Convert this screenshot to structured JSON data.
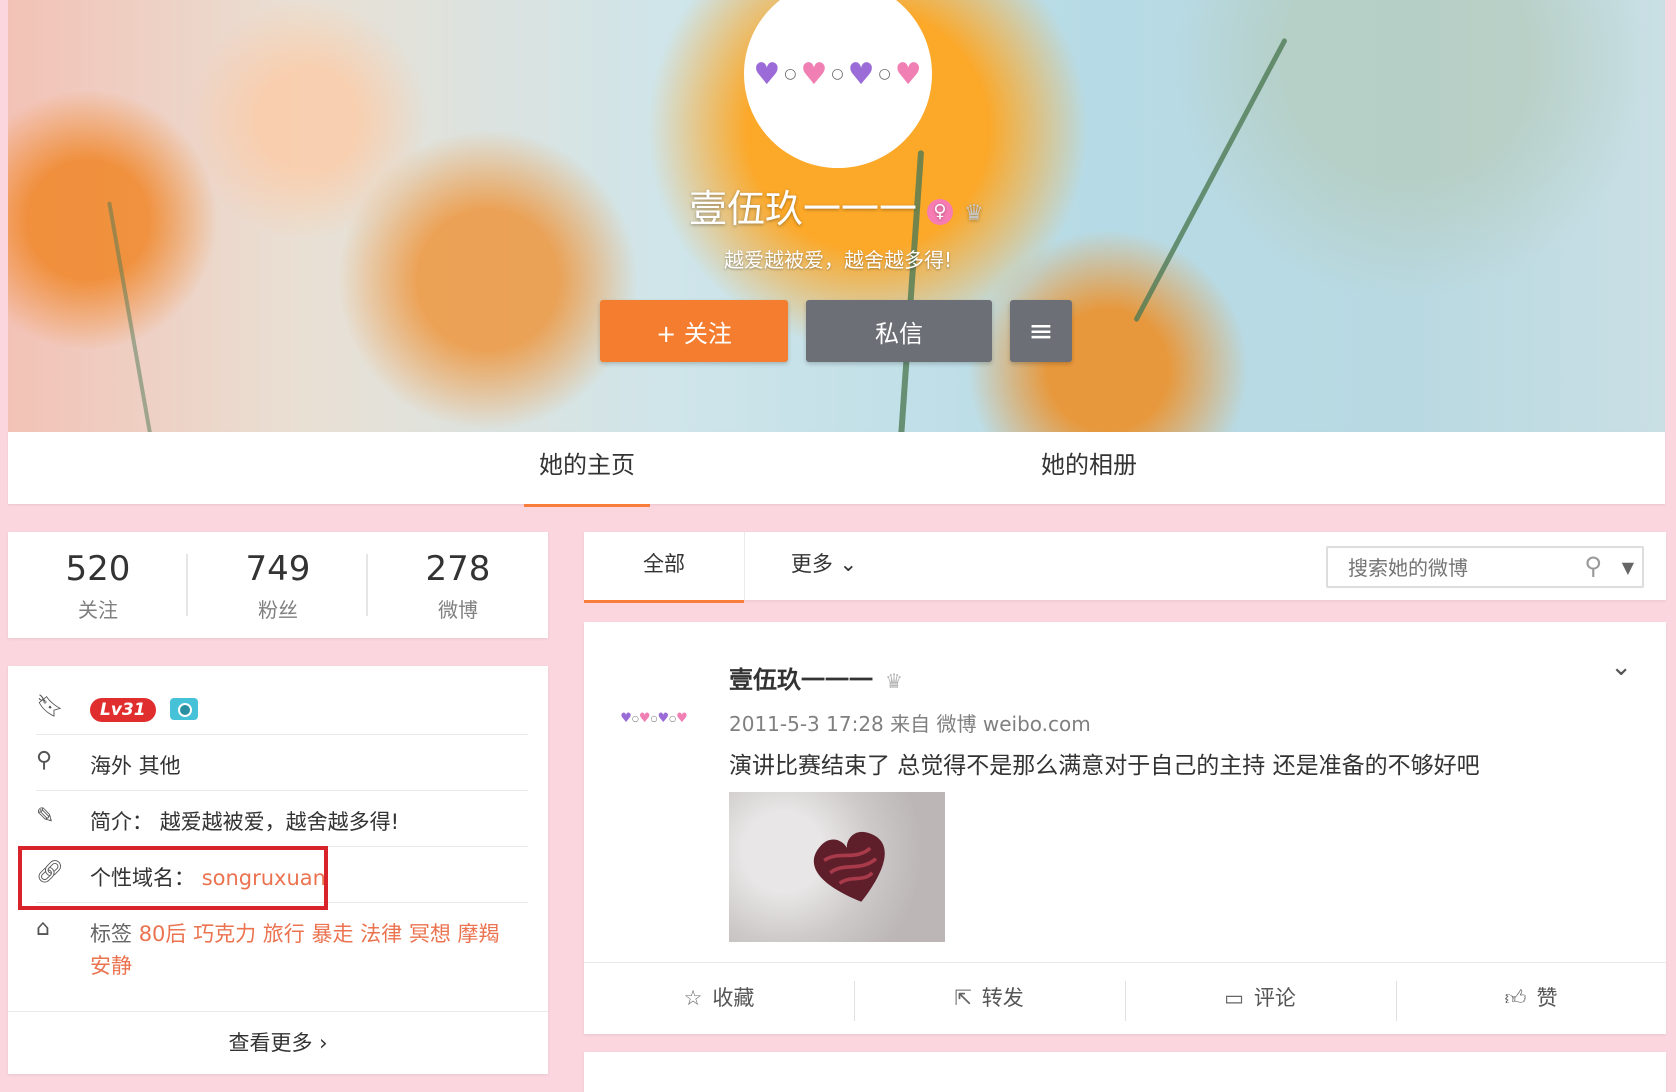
{
  "profile": {
    "name": "壹伍玖一一一",
    "bio": "越爱越被爱，越舍越多得!",
    "follow_button": "+ 关注",
    "message_button": "私信",
    "menu_button": "≡"
  },
  "nav_tabs": [
    {
      "label": "她的主页",
      "active": true
    },
    {
      "label": "她的相册",
      "active": false
    }
  ],
  "stats": [
    {
      "value": "520",
      "label": "关注"
    },
    {
      "value": "749",
      "label": "粉丝"
    },
    {
      "value": "278",
      "label": "微博"
    }
  ],
  "info": {
    "level_badge": "Lv31",
    "location": "海外 其他",
    "intro_label": "简介：",
    "intro_value": "越爱越被爱，越舍越多得!",
    "domain_label": "个性域名：",
    "domain_value": "songruxuan",
    "tags_label": "标签",
    "tags": [
      "80后",
      "巧克力",
      "旅行",
      "暴走",
      "法律",
      "冥想",
      "摩羯",
      "安静"
    ],
    "view_more": "查看更多 ›"
  },
  "feed_filter": {
    "tab_all": "全部",
    "tab_more": "更多 ⌄",
    "search_placeholder": "搜索她的微博"
  },
  "post": {
    "author": "壹伍玖一一一",
    "meta": "2011-5-3 17:28 来自 微博 weibo.com",
    "text": "演讲比赛结束了  总觉得不是那么满意对于自己的主持 还是准备的不够好吧",
    "actions": [
      {
        "icon": "star-icon",
        "label": "收藏"
      },
      {
        "icon": "share-icon",
        "label": "转发"
      },
      {
        "icon": "comment-icon",
        "label": "评论"
      },
      {
        "icon": "thumbs-up-icon",
        "label": "赞"
      }
    ]
  },
  "colors": {
    "accent": "#fa7d3c",
    "follow_button": "#f47d2f",
    "gray_button": "#6c6f76",
    "link": "#eb7350",
    "highlight_box": "#d9232a",
    "page_bg": "#fbd6df"
  }
}
